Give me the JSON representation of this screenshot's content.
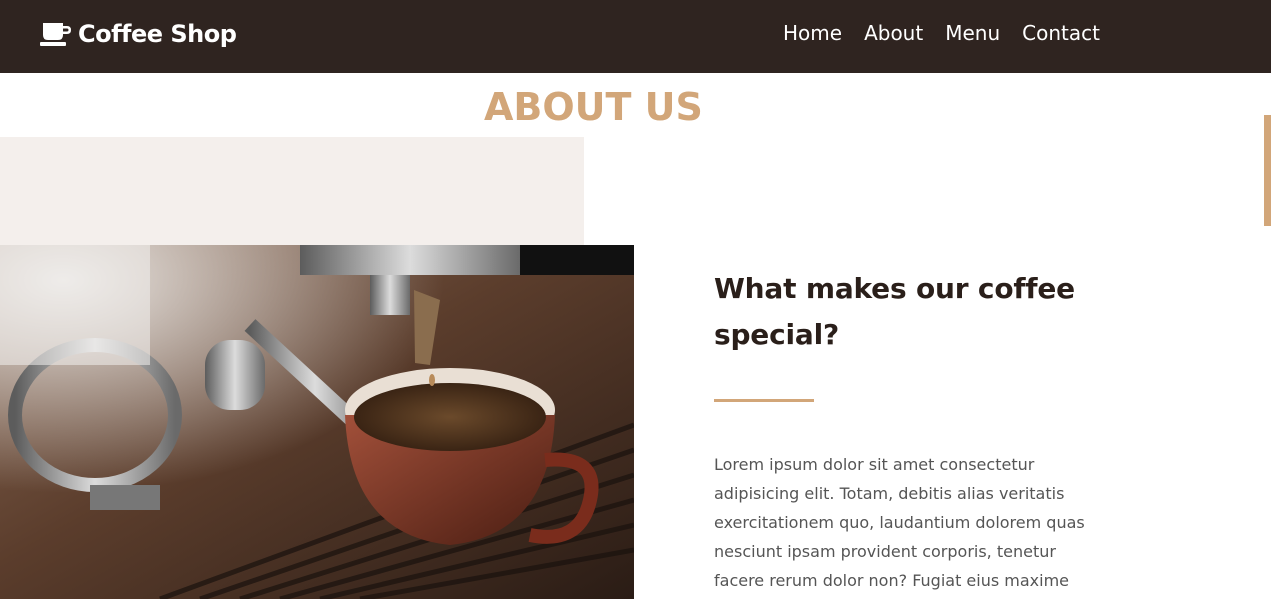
{
  "navbar": {
    "brand": "Coffee Shop",
    "brand_icon": "coffee-cup-icon",
    "links": [
      "Home",
      "About",
      "Menu",
      "Contact"
    ]
  },
  "about": {
    "title": "ABOUT US",
    "heading": "What makes our coffee special?",
    "body": "Lorem ipsum dolor sit amet consectetur adipisicing elit. Totam, debitis alias veritatis exercitationem quo, laudantium dolorem quas nesciunt ipsam provident corporis, tenetur facere rerum dolor non? Fugiat eius maxime aperiam!"
  },
  "colors": {
    "nav_bg": "#2f2420",
    "accent": "#d2a679",
    "beige": "#f4efec",
    "heading": "#2a1f1a",
    "text": "#555555"
  }
}
